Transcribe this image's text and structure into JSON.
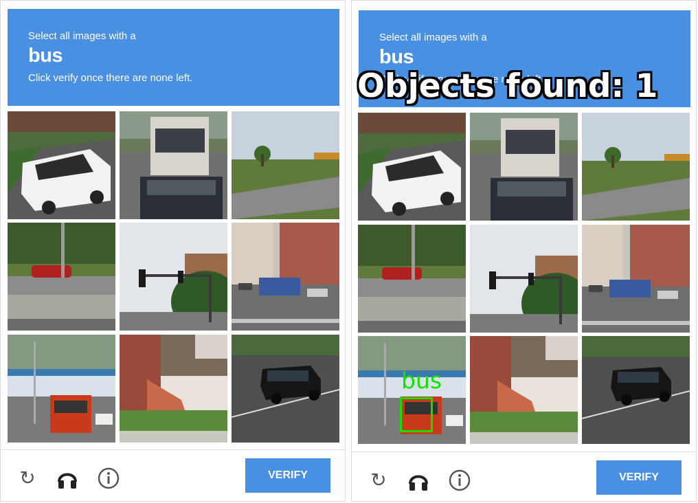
{
  "left_panel": {
    "header": {
      "line1": "Select all images with a",
      "target": "bus",
      "line3": "Click verify once there are none left."
    },
    "footer": {
      "reload_icon": "reload-icon",
      "audio_icon": "headphones-icon",
      "info_icon": "info-icon",
      "verify_label": "VERIFY"
    }
  },
  "right_panel": {
    "header": {
      "line1": "Select all images with a",
      "target": "bus",
      "line3": "Click verify once there are none left."
    },
    "overlay_text": "Objects found: 1",
    "detection_label": "bus",
    "footer": {
      "reload_icon": "reload-icon",
      "audio_icon": "headphones-icon",
      "info_icon": "info-icon",
      "verify_label": "VERIFY"
    }
  },
  "tiles": [
    "white minivan on street",
    "bus front behind car",
    "road with grass and trees",
    "highway barrier with red car",
    "traffic light over road",
    "city street with blue bus",
    "street with orange bus",
    "brick house with stairs",
    "black SUV on road"
  ],
  "colors": {
    "header": "#4a90e2",
    "verify": "#4a90e2",
    "detection": "#15e000"
  }
}
